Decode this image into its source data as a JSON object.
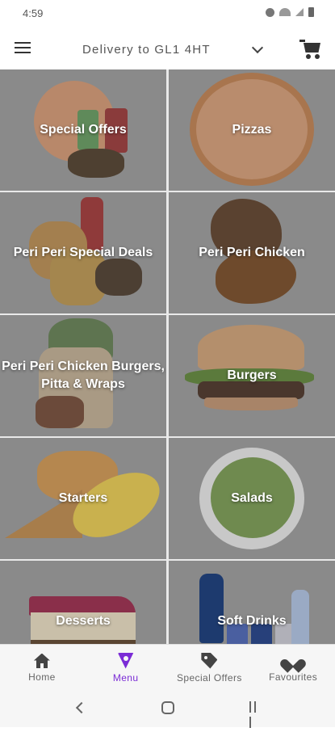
{
  "status_bar": {
    "time": "4:59"
  },
  "header": {
    "delivery_label": "Delivery to GL1 4HT"
  },
  "categories": [
    {
      "label": "Special Offers"
    },
    {
      "label": "Pizzas"
    },
    {
      "label": "Peri Peri Special Deals"
    },
    {
      "label": "Peri Peri Chicken"
    },
    {
      "label": "Peri Peri Chicken Burgers, Pitta & Wraps"
    },
    {
      "label": "Burgers"
    },
    {
      "label": "Starters"
    },
    {
      "label": "Salads"
    },
    {
      "label": "Desserts"
    },
    {
      "label": "Soft Drinks"
    }
  ],
  "bottom_nav": {
    "active": "Menu",
    "items": [
      {
        "label": "Home",
        "icon": "home-icon"
      },
      {
        "label": "Menu",
        "icon": "menu-pizza-icon"
      },
      {
        "label": "Special Offers",
        "icon": "tag-icon"
      },
      {
        "label": "Favourites",
        "icon": "heart-icon"
      }
    ]
  },
  "colors": {
    "accent": "#7b2cd6",
    "tile_overlay": "#8a8a8a"
  }
}
